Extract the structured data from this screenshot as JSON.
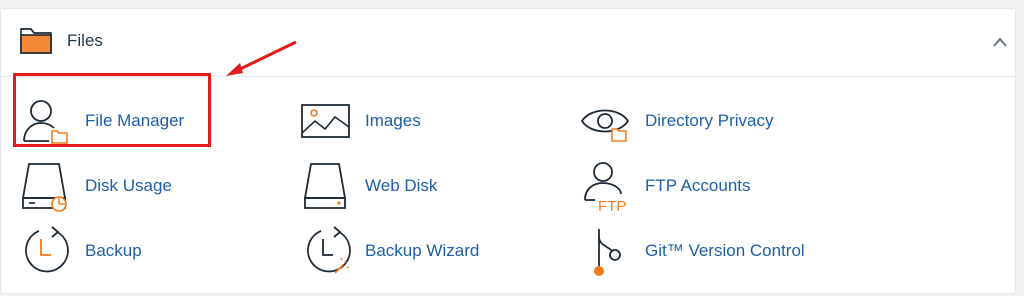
{
  "section": {
    "title": "Files",
    "collapse_icon": "chevron-up-icon",
    "folder_icon": "folder-icon"
  },
  "items": [
    {
      "label": "File Manager",
      "icon": "user-folder-icon"
    },
    {
      "label": "Images",
      "icon": "image-icon"
    },
    {
      "label": "Directory Privacy",
      "icon": "eye-folder-icon"
    },
    {
      "label": "Disk Usage",
      "icon": "disk-pie-icon"
    },
    {
      "label": "Web Disk",
      "icon": "drive-icon"
    },
    {
      "label": "FTP Accounts",
      "icon": "user-ftp-icon",
      "icon_text": "FTP"
    },
    {
      "label": "Backup",
      "icon": "clock-arrow-icon"
    },
    {
      "label": "Backup Wizard",
      "icon": "clock-wand-icon"
    },
    {
      "label": "Git™ Version Control",
      "icon": "git-branch-icon"
    }
  ],
  "colors": {
    "accent": "#f47b20",
    "link": "#1f5ea8",
    "highlight": "#e21b1b",
    "icon_stroke": "#1e2a36"
  }
}
